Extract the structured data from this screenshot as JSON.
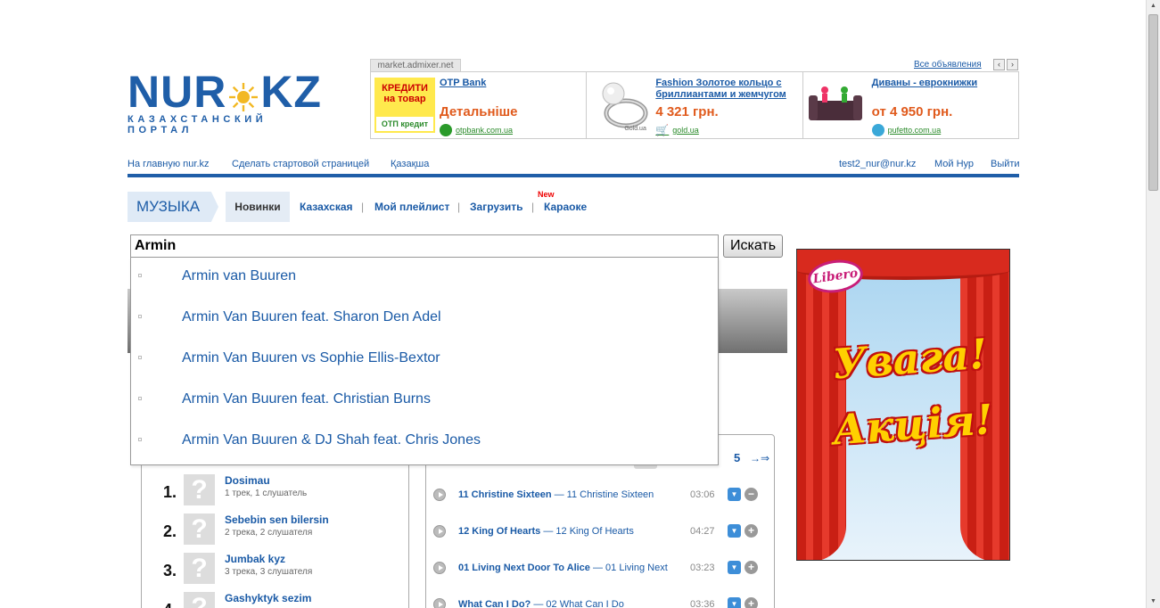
{
  "logo": {
    "text_left": "NUR",
    "text_right": "KZ",
    "subtitle": "КАЗАХСТАНСКИЙ ПОРТАЛ"
  },
  "ads": {
    "source_tab": "market.admixer.net",
    "all_link": "Все объявления",
    "prev": "‹",
    "next": "›",
    "items": [
      {
        "title": "OTP Bank",
        "price": "Детальніше",
        "source": "otpbank.com.ua",
        "thumb_label_1": "КРЕДИТИ на товар",
        "thumb_label_2": "ОТП кредит"
      },
      {
        "title": "Fashion Золотое кольцо с бриллиантами и жемчугом",
        "price": "4 321 грн.",
        "source": "gold.ua",
        "thumb_label_1": "Gold.ua"
      },
      {
        "title": "Диваны - еврокнижки",
        "price": "от 4 950 грн.",
        "source": "pufetto.com.ua"
      }
    ]
  },
  "topnav": {
    "home": "На главную nur.kz",
    "make_start": "Сделать стартовой страницей",
    "kazakh": "Қазақша",
    "user_email": "test2_nur@nur.kz",
    "my_nur": "Мой Нур",
    "logout": "Выйти"
  },
  "music_menu": {
    "section_label": "МУЗЫКА",
    "items": [
      "Новинки",
      "Казахская",
      "Мой плейлист",
      "Загрузить",
      "Караоке"
    ],
    "separator": "|",
    "new_badge": "New"
  },
  "search": {
    "value": "Armin",
    "button": "Искать",
    "suggestions": [
      "Armin van Buuren",
      "Armin Van Buuren feat. Sharon Den Adel",
      "Armin Van Buuren vs Sophie Ellis-Bextor",
      "Armin Van Buuren feat. Christian Burns",
      "Armin Van Buuren & DJ Shah feat. Chris Jones"
    ]
  },
  "artists": [
    {
      "rank": "1.",
      "name": "Dosimau",
      "meta": "1 трек, 1 слушатель"
    },
    {
      "rank": "2.",
      "name": "Sebebin sen bilersin",
      "meta": "2 трека, 2 слушателя"
    },
    {
      "rank": "3.",
      "name": "Jumbak kyz",
      "meta": "3 трека, 3 слушателя"
    },
    {
      "rank": "4.",
      "name": "Gashyktyk sezim",
      "meta": ""
    }
  ],
  "pager": {
    "page": "5",
    "next": "→⇒"
  },
  "tracks": [
    {
      "artist": "11 Christine Sixteen",
      "title": "— 11 Christine Sixteen",
      "duration": "03:06",
      "action": "−"
    },
    {
      "artist": "12 King Of Hearts",
      "title": "— 12 King Of Hearts",
      "duration": "04:27",
      "action": "+"
    },
    {
      "artist": "01 Living Next Door To Alice",
      "title": "— 01 Living Next",
      "duration": "03:23",
      "action": "+"
    },
    {
      "artist": "What Can I Do?",
      "title": "— 02 What Can I Do",
      "duration": "03:36",
      "action": "+"
    }
  ],
  "banner": {
    "brand": "Libero",
    "line1": "Увага!",
    "line2": "Акція!"
  },
  "colors": {
    "brand_blue": "#1f5ea8",
    "link": "#1a5aa6",
    "price": "#e05a1c",
    "accent_red": "#e00000"
  }
}
